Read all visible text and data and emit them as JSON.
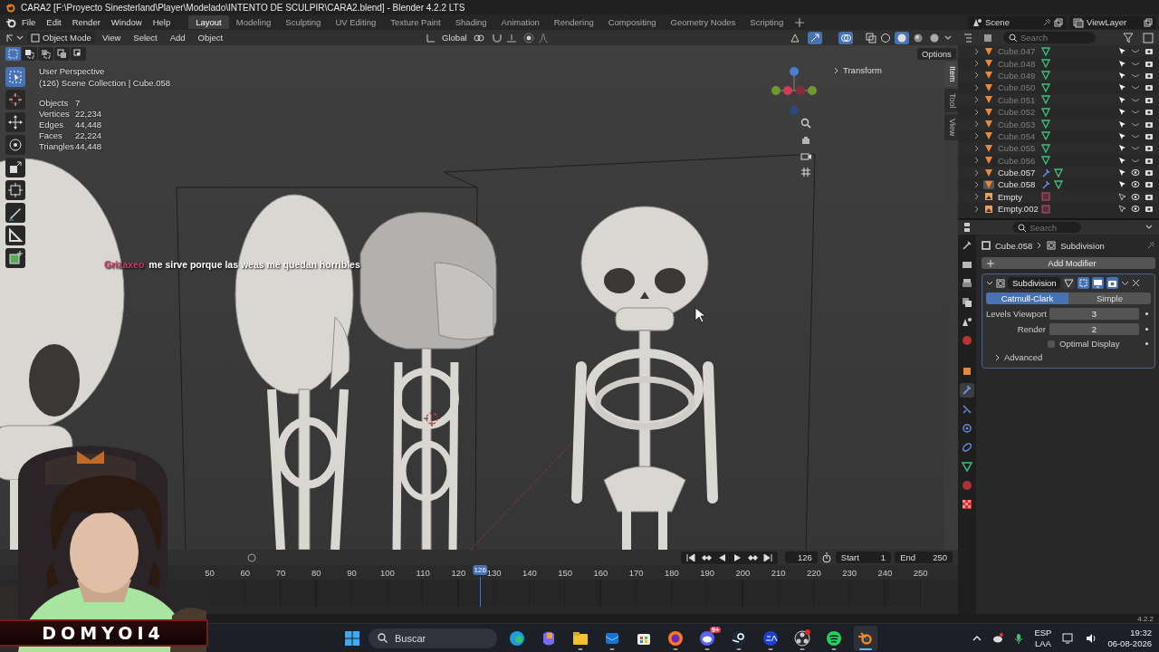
{
  "window": {
    "title": "CARA2 [F:\\Proyecto Sinesterland\\Player\\Modelado\\INTENTO DE SCULPIR\\CARA2.blend] - Blender 4.2.2 LTS"
  },
  "menu": [
    "File",
    "Edit",
    "Render",
    "Window",
    "Help"
  ],
  "workspaces": [
    {
      "label": "Layout",
      "selected": true
    },
    {
      "label": "Modeling",
      "selected": false
    },
    {
      "label": "Sculpting",
      "selected": false
    },
    {
      "label": "UV Editing",
      "selected": false
    },
    {
      "label": "Texture Paint",
      "selected": false
    },
    {
      "label": "Shading",
      "selected": false
    },
    {
      "label": "Animation",
      "selected": false
    },
    {
      "label": "Rendering",
      "selected": false
    },
    {
      "label": "Compositing",
      "selected": false
    },
    {
      "label": "Geometry Nodes",
      "selected": false
    },
    {
      "label": "Scripting",
      "selected": false
    }
  ],
  "scene_selector": {
    "scene": "Scene",
    "view_layer": "ViewLayer"
  },
  "viewport_header": {
    "mode": "Object Mode",
    "menus": [
      "View",
      "Select",
      "Add",
      "Object"
    ],
    "orientation": "Global",
    "options": "Options",
    "gizmos": true,
    "overlays": true,
    "shading": [
      {
        "kind": "wireframe",
        "selected": false
      },
      {
        "kind": "solid",
        "selected": true
      },
      {
        "kind": "material",
        "selected": false
      },
      {
        "kind": "rendered",
        "selected": false
      }
    ]
  },
  "select_modes": [
    {
      "kind": "new",
      "selected": true
    },
    {
      "kind": "extend",
      "selected": false
    },
    {
      "kind": "subtract",
      "selected": false
    },
    {
      "kind": "invert",
      "selected": false
    },
    {
      "kind": "intersect",
      "selected": false
    }
  ],
  "tools": [
    {
      "kind": "select",
      "selected": true
    },
    {
      "kind": "cursor",
      "selected": false
    },
    {
      "kind": "move",
      "selected": false
    },
    {
      "kind": "rotate",
      "selected": false
    },
    {
      "kind": "scale",
      "selected": false
    },
    {
      "kind": "transform",
      "selected": false
    },
    {
      "kind": "annotate",
      "selected": false
    },
    {
      "kind": "measure",
      "selected": false
    },
    {
      "kind": "add_cube",
      "selected": false
    }
  ],
  "viewport": {
    "view_name": "User Perspective",
    "context": "(126) Scene Collection | Cube.058",
    "stats": [
      {
        "label": "Objects",
        "value": "7"
      },
      {
        "label": "Vertices",
        "value": "22,234"
      },
      {
        "label": "Edges",
        "value": "44,448"
      },
      {
        "label": "Faces",
        "value": "22,224"
      },
      {
        "label": "Triangles",
        "value": "44,448"
      }
    ]
  },
  "n_panel": {
    "panel": "Transform",
    "tabs": [
      {
        "label": "Item",
        "selected": true
      },
      {
        "label": "Tool",
        "selected": false
      },
      {
        "label": "View",
        "selected": false
      }
    ]
  },
  "chat": {
    "user": "Grizaxeo",
    "message": "me sirve porque las weas me quedan horribles"
  },
  "stream_banner": "DOMYOI4",
  "timeline": {
    "current_frame": "126",
    "start_label": "Start",
    "start": "1",
    "end_label": "End",
    "end": "250",
    "playhead": {
      "label": "126",
      "level": 0.38
    },
    "ticks": [
      "50",
      "60",
      "70",
      "80",
      "90",
      "100",
      "110",
      "120",
      "130",
      "140",
      "150",
      "160",
      "170",
      "180",
      "190",
      "200",
      "210",
      "220",
      "230",
      "240",
      "250"
    ]
  },
  "outliner": {
    "search_placeholder": "Search",
    "items": [
      {
        "name": "Cube.047",
        "kind": "mesh",
        "selected": false,
        "visible": false,
        "modifier": false
      },
      {
        "name": "Cube.048",
        "kind": "mesh",
        "selected": false,
        "visible": false,
        "modifier": false
      },
      {
        "name": "Cube.049",
        "kind": "mesh",
        "selected": false,
        "visible": false,
        "modifier": false
      },
      {
        "name": "Cube.050",
        "kind": "mesh",
        "selected": false,
        "visible": false,
        "modifier": false
      },
      {
        "name": "Cube.051",
        "kind": "mesh",
        "selected": false,
        "visible": false,
        "modifier": false
      },
      {
        "name": "Cube.052",
        "kind": "mesh",
        "selected": false,
        "visible": false,
        "modifier": false
      },
      {
        "name": "Cube.053",
        "kind": "mesh",
        "selected": false,
        "visible": false,
        "modifier": false
      },
      {
        "name": "Cube.054",
        "kind": "mesh",
        "selected": false,
        "visible": false,
        "modifier": false
      },
      {
        "name": "Cube.055",
        "kind": "mesh",
        "selected": false,
        "visible": false,
        "modifier": false
      },
      {
        "name": "Cube.056",
        "kind": "mesh",
        "selected": false,
        "visible": false,
        "modifier": false
      },
      {
        "name": "Cube.057",
        "kind": "mesh",
        "selected": false,
        "visible": true,
        "modifier": true
      },
      {
        "name": "Cube.058",
        "kind": "mesh",
        "selected": true,
        "visible": true,
        "modifier": true
      },
      {
        "name": "Empty",
        "kind": "empty",
        "selected": false,
        "visible": true,
        "modifier": false
      },
      {
        "name": "Empty.002",
        "kind": "empty",
        "selected": false,
        "visible": true,
        "modifier": false
      }
    ]
  },
  "properties": {
    "search_placeholder": "Search",
    "object": "Cube.058",
    "modifier": "Subdivision",
    "add_modifier": "Add Modifier",
    "tabs": [
      {
        "kind": "tool",
        "selected": false
      },
      {
        "kind": "render",
        "selected": false
      },
      {
        "kind": "output",
        "selected": false
      },
      {
        "kind": "view_layer",
        "selected": false
      },
      {
        "kind": "scene",
        "selected": false
      },
      {
        "kind": "world",
        "selected": false
      },
      {
        "kind": "object",
        "selected": false
      },
      {
        "kind": "modifier",
        "selected": true
      },
      {
        "kind": "particles",
        "selected": false
      },
      {
        "kind": "physics",
        "selected": false
      },
      {
        "kind": "constraints",
        "selected": false
      },
      {
        "kind": "data",
        "selected": false
      },
      {
        "kind": "material",
        "selected": false
      },
      {
        "kind": "texture",
        "selected": false
      }
    ],
    "panel": {
      "name": "Subdivision",
      "toggles": [
        {
          "kind": "edit_mode",
          "on": false
        },
        {
          "kind": "on_cage",
          "on": true
        },
        {
          "kind": "viewport",
          "on": true
        },
        {
          "kind": "render",
          "on": true
        }
      ],
      "types": [
        {
          "label": "Catmull-Clark",
          "selected": true
        },
        {
          "label": "Simple",
          "selected": false
        }
      ],
      "fields": [
        {
          "label": "Levels Viewport",
          "value": "3"
        },
        {
          "label": "Render",
          "value": "2"
        }
      ],
      "optimal_display": {
        "label": "Optimal Display",
        "checked": false
      },
      "advanced": {
        "label": "Advanced",
        "expanded": false
      }
    }
  },
  "version": "4.2.2",
  "taskbar": {
    "search_placeholder": "Buscar",
    "language": "ESP",
    "layout": "LAA",
    "time": "19:32",
    "date": "06-08-2026",
    "apps": [
      {
        "kind": "edge",
        "running": false,
        "active": false
      },
      {
        "kind": "copilot",
        "running": false,
        "active": false
      },
      {
        "kind": "explorer",
        "running": true,
        "active": false
      },
      {
        "kind": "outlook",
        "running": true,
        "active": false
      },
      {
        "kind": "store",
        "running": false,
        "active": false
      },
      {
        "kind": "firefox",
        "running": true,
        "active": false
      },
      {
        "kind": "discord",
        "running": true,
        "active": false,
        "badge": "9+"
      },
      {
        "kind": "steam",
        "running": true,
        "active": false
      },
      {
        "kind": "ea",
        "running": true,
        "active": false
      },
      {
        "kind": "obs",
        "running": true,
        "active": false
      },
      {
        "kind": "spotify",
        "running": true,
        "active": false
      },
      {
        "kind": "blender",
        "running": true,
        "active": true
      }
    ]
  }
}
